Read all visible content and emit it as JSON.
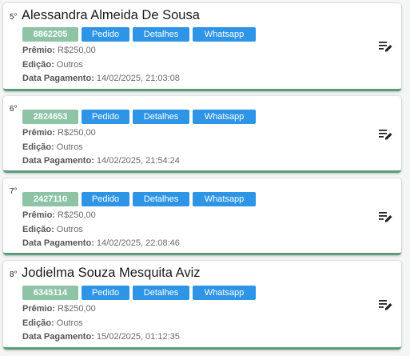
{
  "labels": {
    "premio": "Prêmio:",
    "edicao": "Edição:",
    "pagamento": "Data Pagamento:"
  },
  "cards": [
    {
      "rank": "5°",
      "name": "Alessandra Almeida De Sousa",
      "code": "8862205",
      "buttons": [
        "Pedido",
        "Detalhes",
        "Whatsapp"
      ],
      "premio": "R$250,00",
      "edicao": "Outros",
      "data_pagamento": "14/02/2025, 21:03:08",
      "action_icon": "playlist-edit-icon"
    },
    {
      "rank": "6°",
      "name": "",
      "code": "2824653",
      "buttons": [
        "Pedido",
        "Detalhes",
        "Whatsapp"
      ],
      "premio": "R$250,00",
      "edicao": "Outros",
      "data_pagamento": "14/02/2025, 21:54:24",
      "action_icon": "playlist-edit-icon"
    },
    {
      "rank": "7°",
      "name": "",
      "code": "2427110",
      "buttons": [
        "Pedido",
        "Detalhes",
        "Whatsapp"
      ],
      "premio": "R$250,00",
      "edicao": "Outros",
      "data_pagamento": "14/02/2025, 22:08:46",
      "action_icon": "playlist-edit-icon"
    },
    {
      "rank": "8°",
      "name": "Jodielma Souza Mesquita Aviz",
      "code": "6345114",
      "buttons": [
        "Pedido",
        "Detalhes",
        "Whatsapp"
      ],
      "premio": "R$250,00",
      "edicao": "Outros",
      "data_pagamento": "15/02/2025, 01:12:35",
      "action_icon": "playlist-edit-icon"
    }
  ],
  "colors": {
    "badge": "#8cc4a5",
    "button": "#2d94e6",
    "card_accent": "#5a9e7a"
  }
}
